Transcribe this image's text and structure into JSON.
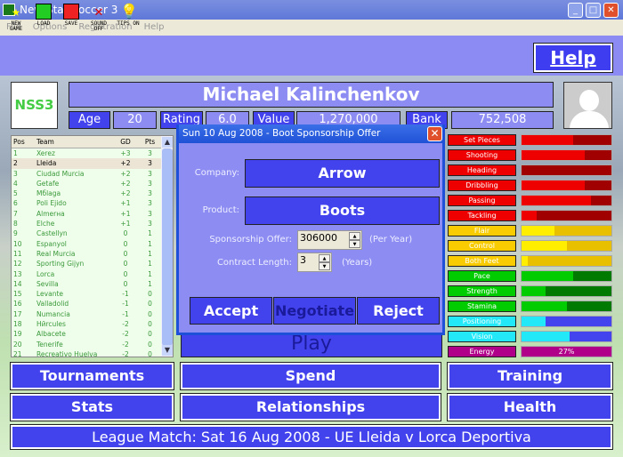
{
  "window": {
    "title": "New Star Soccer 3",
    "app_icon": "NSS3"
  },
  "menu": [
    "File",
    "Options",
    "Registration",
    "Help"
  ],
  "toolbar": [
    {
      "label": "NEW GAME",
      "icon": "star-icon"
    },
    {
      "label": "LOAD",
      "icon": "floppy-green-icon"
    },
    {
      "label": "SAVE",
      "icon": "floppy-red-icon"
    },
    {
      "label": "SOUND OFF",
      "icon": "sound-off-icon"
    },
    {
      "label": "TIPS ON",
      "icon": "lightbulb-icon"
    }
  ],
  "help_label": "Help",
  "logo_text": "NSS3",
  "player": {
    "name": "Michael Kalinchenkov",
    "age_label": "Age",
    "age": "20",
    "rating_label": "Rating",
    "rating": "6.0",
    "value_label": "Value",
    "value": "1,270,000",
    "bank_label": "Bank",
    "bank": "752,508"
  },
  "league": {
    "headers": [
      "Pos",
      "Team",
      "GD",
      "Pts"
    ],
    "selected_index": 1,
    "rows": [
      [
        "1",
        "Xerez",
        "+3",
        "3"
      ],
      [
        "2",
        "Lleida",
        "+2",
        "3"
      ],
      [
        "3",
        "Ciudad Murcia",
        "+2",
        "3"
      ],
      [
        "4",
        "Getafe",
        "+2",
        "3"
      ],
      [
        "5",
        "Mбlaga",
        "+2",
        "3"
      ],
      [
        "6",
        "Poli Ejido",
        "+1",
        "3"
      ],
      [
        "7",
        "Almerнa",
        "+1",
        "3"
      ],
      [
        "8",
        "Elche",
        "+1",
        "3"
      ],
      [
        "9",
        "Castellуn",
        "0",
        "1"
      ],
      [
        "10",
        "Espanyol",
        "0",
        "1"
      ],
      [
        "11",
        "Real Murcia",
        "0",
        "1"
      ],
      [
        "12",
        "Sporting Gijуn",
        "0",
        "1"
      ],
      [
        "13",
        "Lorca",
        "0",
        "1"
      ],
      [
        "14",
        "Sevilla",
        "0",
        "1"
      ],
      [
        "15",
        "Levante",
        "-1",
        "0"
      ],
      [
        "16",
        "Valladolid",
        "-1",
        "0"
      ],
      [
        "17",
        "Numancia",
        "-1",
        "0"
      ],
      [
        "18",
        "Hйrcules",
        "-2",
        "0"
      ],
      [
        "19",
        "Albacete",
        "-2",
        "0"
      ],
      [
        "20",
        "Tenerife",
        "-2",
        "0"
      ],
      [
        "21",
        "Recreativo Huelva",
        "-2",
        "0"
      ]
    ]
  },
  "skills": [
    {
      "label": "Set Pieces",
      "level": 0.57,
      "color": "#ee0000",
      "track": "#a00000"
    },
    {
      "label": "Shooting",
      "level": 0.7,
      "color": "#ee0000",
      "track": "#a00000"
    },
    {
      "label": "Heading",
      "level": 0.0,
      "color": "#ee0000",
      "track": "#a00000"
    },
    {
      "label": "Dribbling",
      "level": 0.7,
      "color": "#ee0000",
      "track": "#a00000"
    },
    {
      "label": "Passing",
      "level": 0.77,
      "color": "#ee0000",
      "track": "#a00000"
    },
    {
      "label": "Tackling",
      "level": 0.17,
      "color": "#ee0000",
      "track": "#a00000"
    },
    {
      "label": "Flair",
      "level": 0.37,
      "color": "#ffee00",
      "track": "#e8c000",
      "label_bg": "#f8cc00"
    },
    {
      "label": "Control",
      "level": 0.5,
      "color": "#ffee00",
      "track": "#e8c000",
      "label_bg": "#f8cc00"
    },
    {
      "label": "Both Feet",
      "level": 0.07,
      "color": "#ffee00",
      "track": "#e8c000",
      "label_bg": "#f8cc00"
    },
    {
      "label": "Pace",
      "level": 0.57,
      "color": "#00cc00",
      "track": "#007a00"
    },
    {
      "label": "Strength",
      "level": 0.27,
      "color": "#00cc00",
      "track": "#007a00"
    },
    {
      "label": "Stamina",
      "level": 0.5,
      "color": "#00cc00",
      "track": "#007a00"
    },
    {
      "label": "Positioning",
      "level": 0.27,
      "color": "#22e8f8",
      "track": "#4444ee"
    },
    {
      "label": "Vision",
      "level": 0.53,
      "color": "#22e8f8",
      "track": "#4444ee"
    }
  ],
  "energy": {
    "label": "Energy",
    "value_text": "27%",
    "color": "#b0008a"
  },
  "play_label": "Play",
  "buttons": {
    "tournaments": "Tournaments",
    "spend": "Spend",
    "training": "Training",
    "stats": "Stats",
    "relationships": "Relationships",
    "health": "Health"
  },
  "footer": "League Match: Sat 16 Aug 2008 - UE Lleida v Lorca Deportiva",
  "dialog": {
    "title": "Sun 10 Aug 2008 - Boot Sponsorship Offer",
    "company_label": "Company:",
    "company": "Arrow",
    "product_label": "Product:",
    "product": "Boots",
    "offer_label": "Sponsorship Offer:",
    "offer": "306000",
    "offer_unit": "(Per Year)",
    "length_label": "Contract Length:",
    "length": "3",
    "length_unit": "(Years)",
    "accept": "Accept",
    "negotiate": "Negotiate",
    "reject": "Reject"
  }
}
